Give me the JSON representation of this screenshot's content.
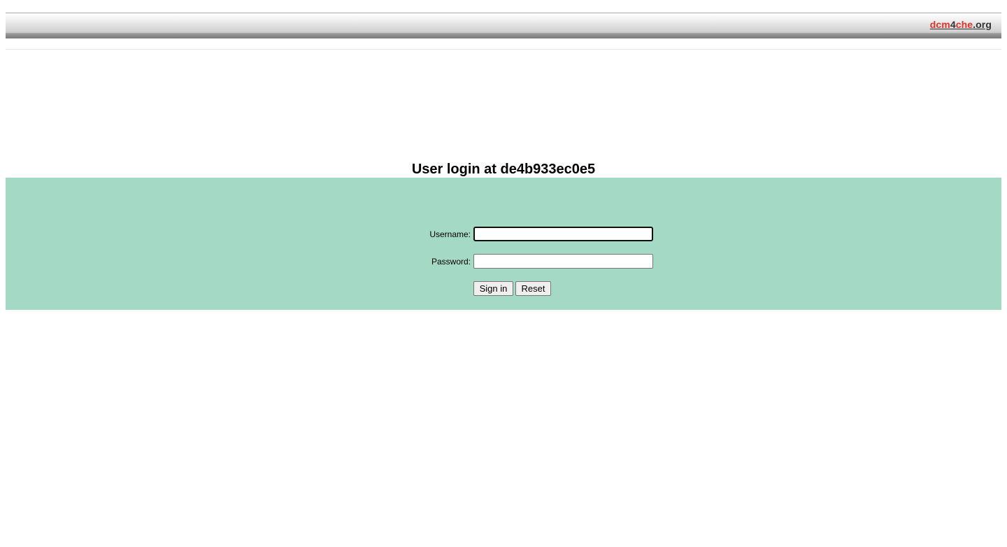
{
  "header": {
    "logo": {
      "part1": "dcm",
      "part2": "4",
      "part3": "che",
      "part4": ".org"
    }
  },
  "login": {
    "title": "User login at de4b933ec0e5",
    "username_label": "Username:",
    "username_value": "",
    "password_label": "Password:",
    "password_value": "",
    "sign_in_label": "Sign in",
    "reset_label": "Reset"
  },
  "colors": {
    "panel_background": "#a4d9c5",
    "logo_red": "#e0342b",
    "logo_dark": "#333333"
  }
}
